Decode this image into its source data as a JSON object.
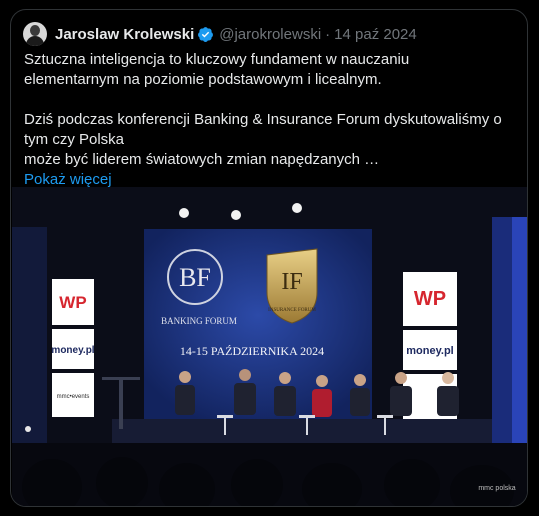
{
  "tweet": {
    "author_name": "Jaroslaw Krolewski",
    "handle": "@jarokrolewski",
    "separator": "·",
    "date": "14 paź 2024",
    "line1": "Sztuczna inteligencja to kluczowy fundament w nauczaniu",
    "line2": "elementarnym na poziomie podstawowym i licealnym.",
    "line3": "Dziś podczas konferencji Banking & Insurance Forum dyskutowaliśmy o",
    "line4a": "tym czy Polska",
    "line4b": "może być liderem światowych zmian napędzanych …",
    "show_more": "Pokaż więcej"
  },
  "photo": {
    "banking_label": "BANKING FORUM",
    "insurance_label": "INSURANCE FORUM",
    "dates": "14-15 PAŹDZIERNIKA 2024",
    "wp_logo": "WP",
    "money_logo": "money.pl",
    "mmc_logo": "mmc•events",
    "watermark": "mmc polska"
  },
  "colors": {
    "link": "#1d9bf0",
    "verified": "#1d9bf0",
    "muted": "#71767b"
  }
}
